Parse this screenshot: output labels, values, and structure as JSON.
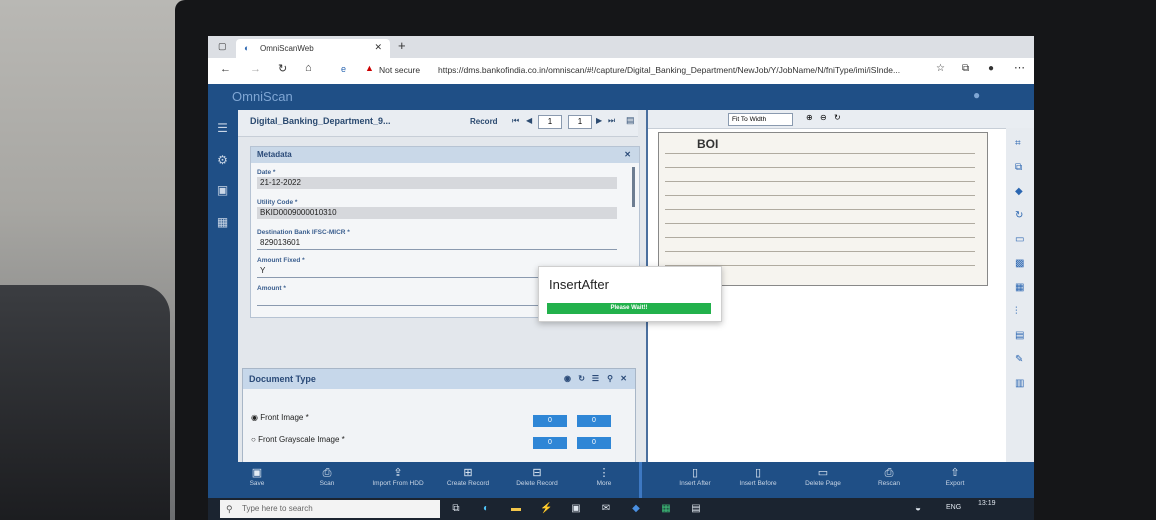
{
  "browser": {
    "tab_title": "OmniScanWeb",
    "security_label": "Not secure",
    "url": "https://dms.bankofindia.co.in/omniscan/#!/capture/Digital_Banking_Department/NewJob/Y/JobName/N/fniType/imi/iSInde..."
  },
  "app": {
    "name": "OmniScan",
    "job_title": "Digital_Banking_Department_9...",
    "record_label": "Record",
    "record_value": "1"
  },
  "metadata": {
    "title": "Metadata",
    "fields": [
      {
        "label": "Date *",
        "value": "21-12-2022"
      },
      {
        "label": "Utility Code *",
        "value": "BKID0009000010310"
      },
      {
        "label": "Destination Bank IFSC-MICR *",
        "value": "829013601"
      },
      {
        "label": "Amount Fixed *",
        "value": "Y"
      },
      {
        "label": "Amount *",
        "value": ""
      }
    ]
  },
  "document_type": {
    "title": "Document Type",
    "options": [
      {
        "label": "Front Image *",
        "selected": true,
        "from": "0",
        "to": "0"
      },
      {
        "label": "Front Grayscale Image *",
        "selected": false,
        "from": "0",
        "to": "0"
      }
    ]
  },
  "viewer": {
    "zoom_label": "Fit To Width",
    "scan_bank": "BOI"
  },
  "modal": {
    "title": "InsertAfter",
    "progress_text": "Please Wait!!"
  },
  "bottom_actions": [
    {
      "label": "Save",
      "icon": "save-icon"
    },
    {
      "label": "Scan",
      "icon": "printer-icon"
    },
    {
      "label": "Import From HDD",
      "icon": "upload-icon"
    },
    {
      "label": "Create Record",
      "icon": "plus-icon"
    },
    {
      "label": "Delete Record",
      "icon": "minus-icon"
    },
    {
      "label": "More",
      "icon": "more-icon"
    },
    {
      "label": "Insert After",
      "icon": "document-icon"
    },
    {
      "label": "Insert Before",
      "icon": "document-icon"
    },
    {
      "label": "Delete Page",
      "icon": "document-minus-icon"
    },
    {
      "label": "Rescan",
      "icon": "printer-icon"
    },
    {
      "label": "Export",
      "icon": "export-icon"
    }
  ],
  "taskbar": {
    "search_placeholder": "Type here to search",
    "language": "ENG",
    "time": "13:19"
  }
}
